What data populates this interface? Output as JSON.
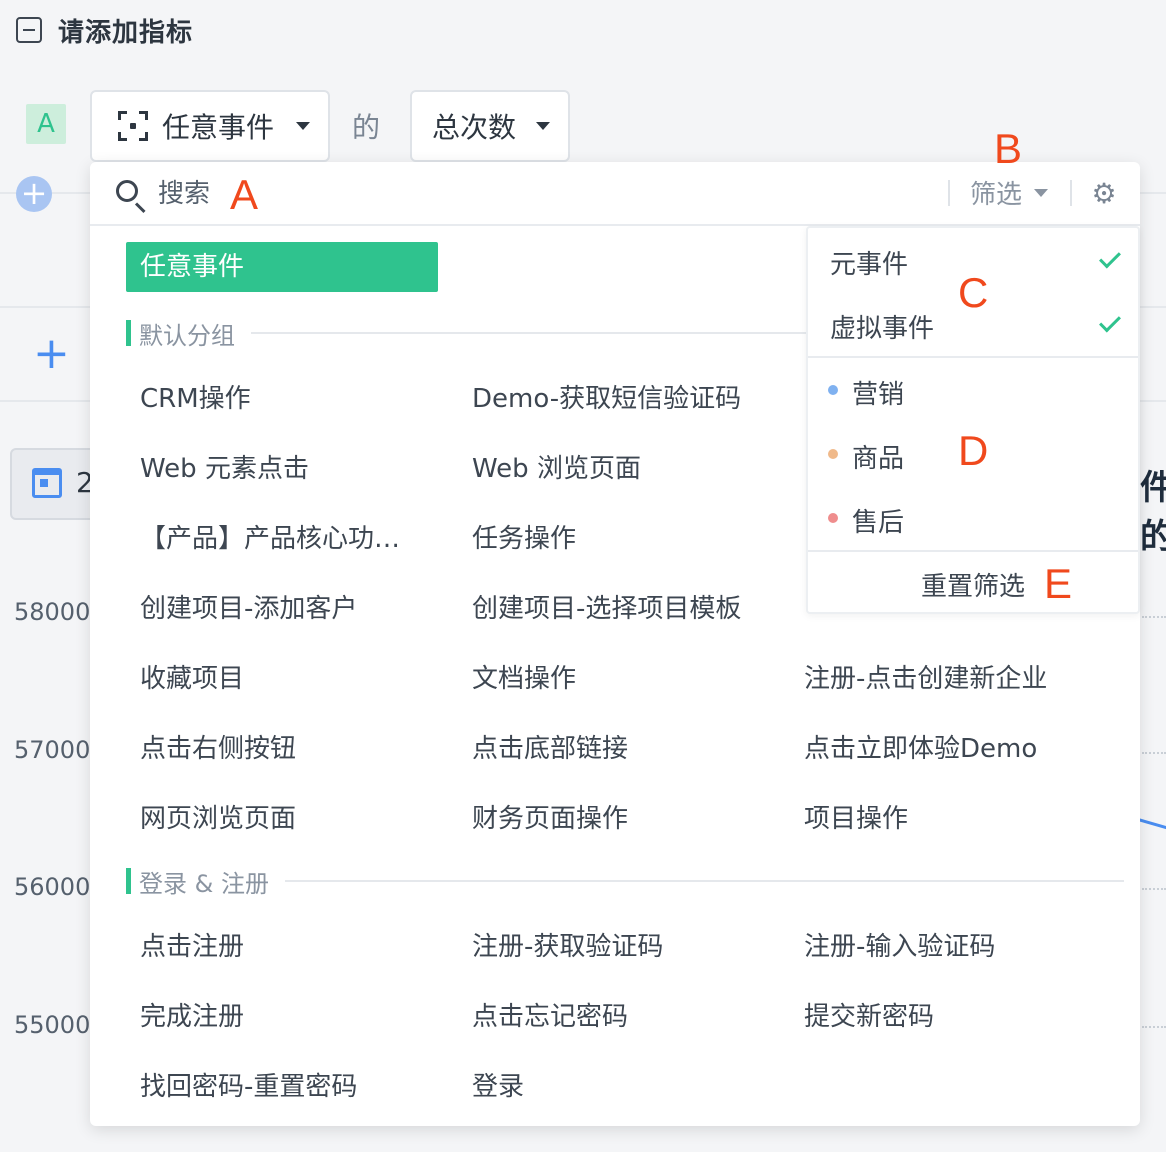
{
  "header": {
    "title": "请添加指标"
  },
  "metric_row": {
    "badge": "A",
    "event_select": "任意事件",
    "connector": "的",
    "agg_select": "总次数"
  },
  "background": {
    "date_partial": "2",
    "right_fragment": "件的",
    "y_ticks": [
      "58000",
      "57000",
      "56000",
      "55000"
    ]
  },
  "search": {
    "placeholder": "搜索"
  },
  "filter": {
    "label": "筛选"
  },
  "selected_event": "任意事件",
  "groups": [
    {
      "name": "默认分组",
      "events": [
        "CRM操作",
        "Demo-获取短信验证码",
        "Web 元素点击",
        "Web 浏览页面",
        "【产品】产品核心功…",
        "任务操作",
        "创建项目-添加客户",
        "创建项目-选择项目模板",
        "收藏项目",
        "文档操作",
        "注册-点击创建新企业",
        "点击右侧按钮",
        "点击底部链接",
        "点击立即体验Demo",
        "网页浏览页面",
        "财务页面操作",
        "项目操作"
      ]
    },
    {
      "name": "登录 & 注册",
      "events": [
        "点击注册",
        "注册-获取验证码",
        "注册-输入验证码",
        "完成注册",
        "点击忘记密码",
        "提交新密码",
        "找回密码-重置密码",
        "登录"
      ]
    }
  ],
  "filter_popover": {
    "types": [
      {
        "label": "元事件",
        "checked": true
      },
      {
        "label": "虚拟事件",
        "checked": true
      }
    ],
    "categories": [
      {
        "label": "营销",
        "color": "#7fb1f0"
      },
      {
        "label": "商品",
        "color": "#f0b98a"
      },
      {
        "label": "售后",
        "color": "#ef8d8d"
      }
    ],
    "reset": "重置筛选"
  },
  "annotations": [
    "A",
    "B",
    "C",
    "D",
    "E"
  ],
  "colors": {
    "accent": "#2fc38e",
    "annotation": "#f0491d",
    "link": "#4a8df0"
  }
}
